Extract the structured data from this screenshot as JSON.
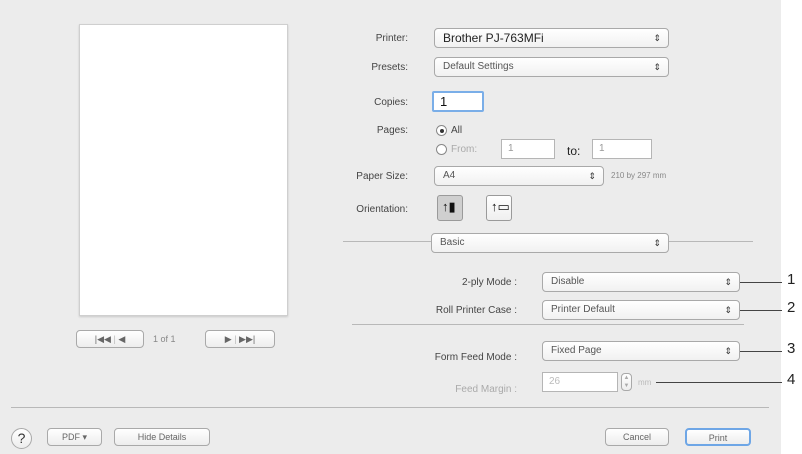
{
  "printer": {
    "label": "Printer:",
    "value": "Brother PJ-763MFi"
  },
  "presets": {
    "label": "Presets:",
    "value": "Default Settings"
  },
  "copies": {
    "label": "Copies:",
    "value": "1"
  },
  "pages": {
    "label": "Pages:",
    "all_label": "All",
    "from_label": "From:",
    "from_value": "1",
    "to_label": "to:",
    "to_value": "1"
  },
  "paper_size": {
    "label": "Paper Size:",
    "value": "A4",
    "dimensions": "210 by 297 mm"
  },
  "orientation": {
    "label": "Orientation:"
  },
  "section": {
    "value": "Basic"
  },
  "ply_mode": {
    "label": "2-ply Mode :",
    "value": "Disable"
  },
  "roll_case": {
    "label": "Roll Printer Case :",
    "value": "Printer Default"
  },
  "form_feed": {
    "label": "Form Feed Mode :",
    "value": "Fixed Page"
  },
  "feed_margin": {
    "label": "Feed Margin :",
    "value": "26",
    "unit": "mm"
  },
  "preview_nav": {
    "first": "|◀◀",
    "prev": "◀",
    "page_label": "1 of 1",
    "next": "▶",
    "last": "▶▶|"
  },
  "footer": {
    "help": "?",
    "pdf": "PDF ▾",
    "hide_details": "Hide Details",
    "cancel": "Cancel",
    "print": "Print"
  },
  "callouts": [
    "1",
    "2",
    "3",
    "4"
  ],
  "colors": {
    "dialog_bg": "#ececec",
    "print_button": "#5da4e8",
    "focus_ring": "#7aaee8"
  }
}
